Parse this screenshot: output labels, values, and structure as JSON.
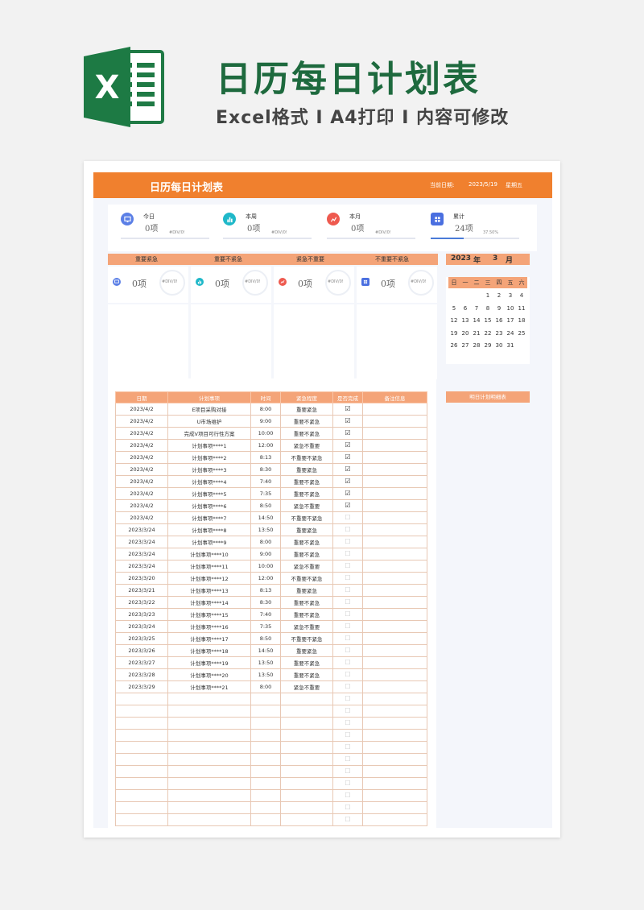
{
  "banner": {
    "logo_letter": "X",
    "title": "日历每日计划表",
    "subtitle": "Excel格式 I A4打印 I 内容可修改"
  },
  "colors": {
    "accent": "#f0802e",
    "accent_light": "#f4a478",
    "brand_green": "#1e6a3e",
    "panel_bg": "#f4f6fb"
  },
  "header": {
    "title": "日历每日计划表",
    "date_label": "当前日期:",
    "date": "2023/5/19",
    "weekday": "星期五"
  },
  "stats": [
    {
      "label": "今日",
      "value": "0项",
      "sub": "#DIV/0!",
      "icon": "monitor-icon",
      "color": "#5b7fe6"
    },
    {
      "label": "本周",
      "value": "0项",
      "sub": "#DIV/0!",
      "icon": "bar-chart-icon",
      "color": "#1fb8c9"
    },
    {
      "label": "本月",
      "value": "0项",
      "sub": "#DIV/0!",
      "icon": "chart-edit-icon",
      "color": "#ee5a4f"
    },
    {
      "label": "累计",
      "value": "24项",
      "sub": "37.50%",
      "icon": "grid-icon",
      "color": "#4a6fe0",
      "progress": 0.375
    }
  ],
  "quadrants": [
    {
      "label": "重要紧急",
      "value": "0项",
      "sub": "#DIV/0!",
      "icon": "monitor-icon",
      "color": "#5b7fe6"
    },
    {
      "label": "重要不紧急",
      "value": "0项",
      "sub": "#DIV/0!",
      "icon": "bar-chart-icon",
      "color": "#1fb8c9"
    },
    {
      "label": "紧急不重要",
      "value": "0项",
      "sub": "#DIV/0!",
      "icon": "chart-edit-icon",
      "color": "#ee5a4f"
    },
    {
      "label": "不重要不紧急",
      "value": "0项",
      "sub": "#DIV/0!",
      "icon": "grid-icon",
      "color": "#4a6fe0"
    }
  ],
  "calendar": {
    "year": "2023",
    "year_unit": "年",
    "month": "3",
    "month_unit": "月",
    "weekdays": [
      "日",
      "一",
      "二",
      "三",
      "四",
      "五",
      "六"
    ],
    "weeks": [
      [
        "",
        "",
        "",
        "1",
        "2",
        "3",
        "4"
      ],
      [
        "5",
        "6",
        "7",
        "8",
        "9",
        "10",
        "11"
      ],
      [
        "12",
        "13",
        "14",
        "15",
        "16",
        "17",
        "18"
      ],
      [
        "19",
        "20",
        "21",
        "22",
        "23",
        "24",
        "25"
      ],
      [
        "26",
        "27",
        "28",
        "29",
        "30",
        "31",
        ""
      ]
    ]
  },
  "tasks": {
    "columns": [
      "日期",
      "计划事项",
      "时间",
      "紧急程度",
      "是否完成",
      "备注信息"
    ],
    "done_symbol": "☑",
    "undone_symbol": "☐",
    "rows": [
      {
        "date": "2023/4/2",
        "item": "E项目采购对接",
        "time": "8:00",
        "level": "重要紧急",
        "done": true
      },
      {
        "date": "2023/4/2",
        "item": "U市场维护",
        "time": "9:00",
        "level": "重要不紧急",
        "done": true
      },
      {
        "date": "2023/4/2",
        "item": "完成V项目可行性方案",
        "time": "10:00",
        "level": "重要不紧急",
        "done": true
      },
      {
        "date": "2023/4/2",
        "item": "计划事项****1",
        "time": "12:00",
        "level": "紧急不重要",
        "done": true
      },
      {
        "date": "2023/4/2",
        "item": "计划事项****2",
        "time": "8:13",
        "level": "不重要不紧急",
        "done": true
      },
      {
        "date": "2023/4/2",
        "item": "计划事项****3",
        "time": "8:30",
        "level": "重要紧急",
        "done": true
      },
      {
        "date": "2023/4/2",
        "item": "计划事项****4",
        "time": "7:40",
        "level": "重要不紧急",
        "done": true
      },
      {
        "date": "2023/4/2",
        "item": "计划事项****5",
        "time": "7:35",
        "level": "重要不紧急",
        "done": true
      },
      {
        "date": "2023/4/2",
        "item": "计划事项****6",
        "time": "8:50",
        "level": "紧急不重要",
        "done": true
      },
      {
        "date": "2023/4/2",
        "item": "计划事项****7",
        "time": "14:50",
        "level": "不重要不紧急",
        "done": false
      },
      {
        "date": "2023/3/24",
        "item": "计划事项****8",
        "time": "13:50",
        "level": "重要紧急",
        "done": false
      },
      {
        "date": "2023/3/24",
        "item": "计划事项****9",
        "time": "8:00",
        "level": "重要不紧急",
        "done": false
      },
      {
        "date": "2023/3/24",
        "item": "计划事项****10",
        "time": "9:00",
        "level": "重要不紧急",
        "done": false
      },
      {
        "date": "2023/3/24",
        "item": "计划事项****11",
        "time": "10:00",
        "level": "紧急不重要",
        "done": false
      },
      {
        "date": "2023/3/20",
        "item": "计划事项****12",
        "time": "12:00",
        "level": "不重要不紧急",
        "done": false
      },
      {
        "date": "2023/3/21",
        "item": "计划事项****13",
        "time": "8:13",
        "level": "重要紧急",
        "done": false
      },
      {
        "date": "2023/3/22",
        "item": "计划事项****14",
        "time": "8:30",
        "level": "重要不紧急",
        "done": false
      },
      {
        "date": "2023/3/23",
        "item": "计划事项****15",
        "time": "7:40",
        "level": "重要不紧急",
        "done": false
      },
      {
        "date": "2023/3/24",
        "item": "计划事项****16",
        "time": "7:35",
        "level": "紧急不重要",
        "done": false
      },
      {
        "date": "2023/3/25",
        "item": "计划事项****17",
        "time": "8:50",
        "level": "不重要不紧急",
        "done": false
      },
      {
        "date": "2023/3/26",
        "item": "计划事项****18",
        "time": "14:50",
        "level": "重要紧急",
        "done": false
      },
      {
        "date": "2023/3/27",
        "item": "计划事项****19",
        "time": "13:50",
        "level": "重要不紧急",
        "done": false
      },
      {
        "date": "2023/3/28",
        "item": "计划事项****20",
        "time": "13:50",
        "level": "重要不紧急",
        "done": false
      },
      {
        "date": "2023/3/29",
        "item": "计划事项****21",
        "time": "8:00",
        "level": "紧急不重要",
        "done": false
      },
      {
        "date": "",
        "item": "",
        "time": "",
        "level": "",
        "done": false
      },
      {
        "date": "",
        "item": "",
        "time": "",
        "level": "",
        "done": false
      },
      {
        "date": "",
        "item": "",
        "time": "",
        "level": "",
        "done": false
      },
      {
        "date": "",
        "item": "",
        "time": "",
        "level": "",
        "done": false
      },
      {
        "date": "",
        "item": "",
        "time": "",
        "level": "",
        "done": false
      },
      {
        "date": "",
        "item": "",
        "time": "",
        "level": "",
        "done": false
      },
      {
        "date": "",
        "item": "",
        "time": "",
        "level": "",
        "done": false
      },
      {
        "date": "",
        "item": "",
        "time": "",
        "level": "",
        "done": false
      },
      {
        "date": "",
        "item": "",
        "time": "",
        "level": "",
        "done": false
      },
      {
        "date": "",
        "item": "",
        "time": "",
        "level": "",
        "done": false
      },
      {
        "date": "",
        "item": "",
        "time": "",
        "level": "",
        "done": false
      }
    ]
  },
  "right_panel": {
    "label": "明日计划明细表"
  }
}
